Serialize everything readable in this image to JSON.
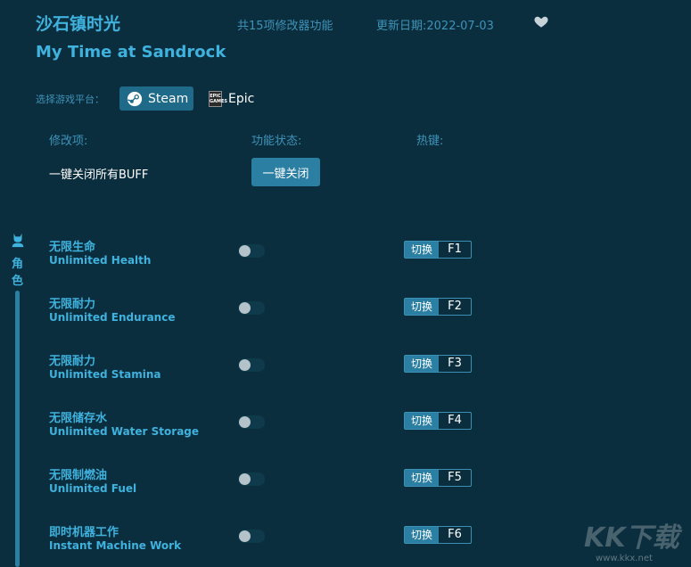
{
  "header": {
    "title_cn": "沙石镇时光",
    "feature_count": "共15项修改器功能",
    "update_date": "更新日期:2022-07-03",
    "title_en": "My Time at Sandrock"
  },
  "platform": {
    "label": "选择游戏平台：",
    "options": [
      {
        "label": "Steam",
        "selected": true
      },
      {
        "label": "Epic",
        "selected": false
      }
    ]
  },
  "columns": {
    "item": "修改项:",
    "status": "功能状态:",
    "hotkey": "热键:"
  },
  "buff": {
    "label": "一键关闭所有BUFF",
    "button": "一键关闭"
  },
  "sidebar": {
    "category": "角色"
  },
  "cheats": [
    {
      "cn": "无限生命",
      "en": "Unlimited Health",
      "switch": "切换",
      "key": "F1",
      "enabled": false
    },
    {
      "cn": "无限耐力",
      "en": "Unlimited Endurance",
      "switch": "切换",
      "key": "F2",
      "enabled": false
    },
    {
      "cn": "无限耐力",
      "en": "Unlimited Stamina",
      "switch": "切换",
      "key": "F3",
      "enabled": false
    },
    {
      "cn": "无限储存水",
      "en": "Unlimited Water Storage",
      "switch": "切换",
      "key": "F4",
      "enabled": false
    },
    {
      "cn": "无限制燃油",
      "en": "Unlimited Fuel",
      "switch": "切换",
      "key": "F5",
      "enabled": false
    },
    {
      "cn": "即时机器工作",
      "en": "Instant Machine Work",
      "switch": "切换",
      "key": "F6",
      "enabled": false
    }
  ],
  "watermark": {
    "logo": "KK下载",
    "url": "www.kkx.net"
  },
  "colors": {
    "background": "#0b2e3e",
    "accent": "#3fb2de",
    "button": "#2a7fa2"
  }
}
